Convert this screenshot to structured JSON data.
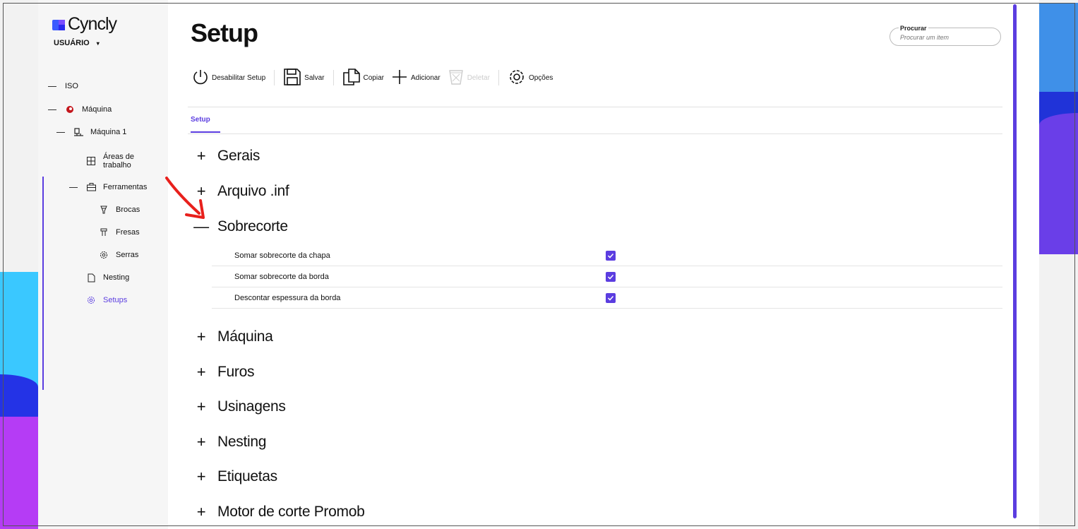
{
  "brand": {
    "name": "Cyncly"
  },
  "user": {
    "label": "USUÁRIO",
    "caret": "▾"
  },
  "sidebar": {
    "items": [
      {
        "label": "ISO",
        "icon": "dash-icon"
      },
      {
        "label": "Máquina",
        "icon": "machine-brand-icon"
      },
      {
        "label": "Máquina 1",
        "icon": "machine-icon"
      },
      {
        "label": "Áreas de trabalho",
        "icon": "grid-icon"
      },
      {
        "label": "Ferramentas",
        "icon": "toolbox-icon"
      },
      {
        "label": "Brocas",
        "icon": "drill-icon"
      },
      {
        "label": "Fresas",
        "icon": "mill-icon"
      },
      {
        "label": "Serras",
        "icon": "saw-gear-icon"
      },
      {
        "label": "Nesting",
        "icon": "document-icon"
      },
      {
        "label": "Setups",
        "icon": "gear-icon",
        "active": true
      }
    ]
  },
  "page": {
    "title": "Setup"
  },
  "search": {
    "label": "Procurar",
    "placeholder": "Procurar um item"
  },
  "toolbar": {
    "disable": "Desabilitar Setup",
    "save": "Salvar",
    "copy": "Copiar",
    "add": "Adicionar",
    "delete": "Deletar",
    "options": "Opções"
  },
  "tabs": [
    {
      "label": "Setup",
      "active": true
    }
  ],
  "sections": [
    {
      "label": "Gerais",
      "expanded": false
    },
    {
      "label": "Arquivo .inf",
      "expanded": false
    },
    {
      "label": "Sobrecorte",
      "expanded": true
    },
    {
      "label": "Máquina",
      "expanded": false
    },
    {
      "label": "Furos",
      "expanded": false
    },
    {
      "label": "Usinagens",
      "expanded": false
    },
    {
      "label": "Nesting",
      "expanded": false
    },
    {
      "label": "Etiquetas",
      "expanded": false
    },
    {
      "label": "Motor de corte Promob",
      "expanded": false
    }
  ],
  "sobrecorte_options": [
    {
      "label": "Somar sobrecorte da chapa",
      "checked": true
    },
    {
      "label": "Somar sobrecorte da borda",
      "checked": true
    },
    {
      "label": "Descontar espessura da borda",
      "checked": true
    }
  ],
  "colors": {
    "accent": "#5b3de0",
    "annotation_arrow": "#e8201c"
  },
  "symbols": {
    "plus": "+",
    "minus": "—"
  }
}
